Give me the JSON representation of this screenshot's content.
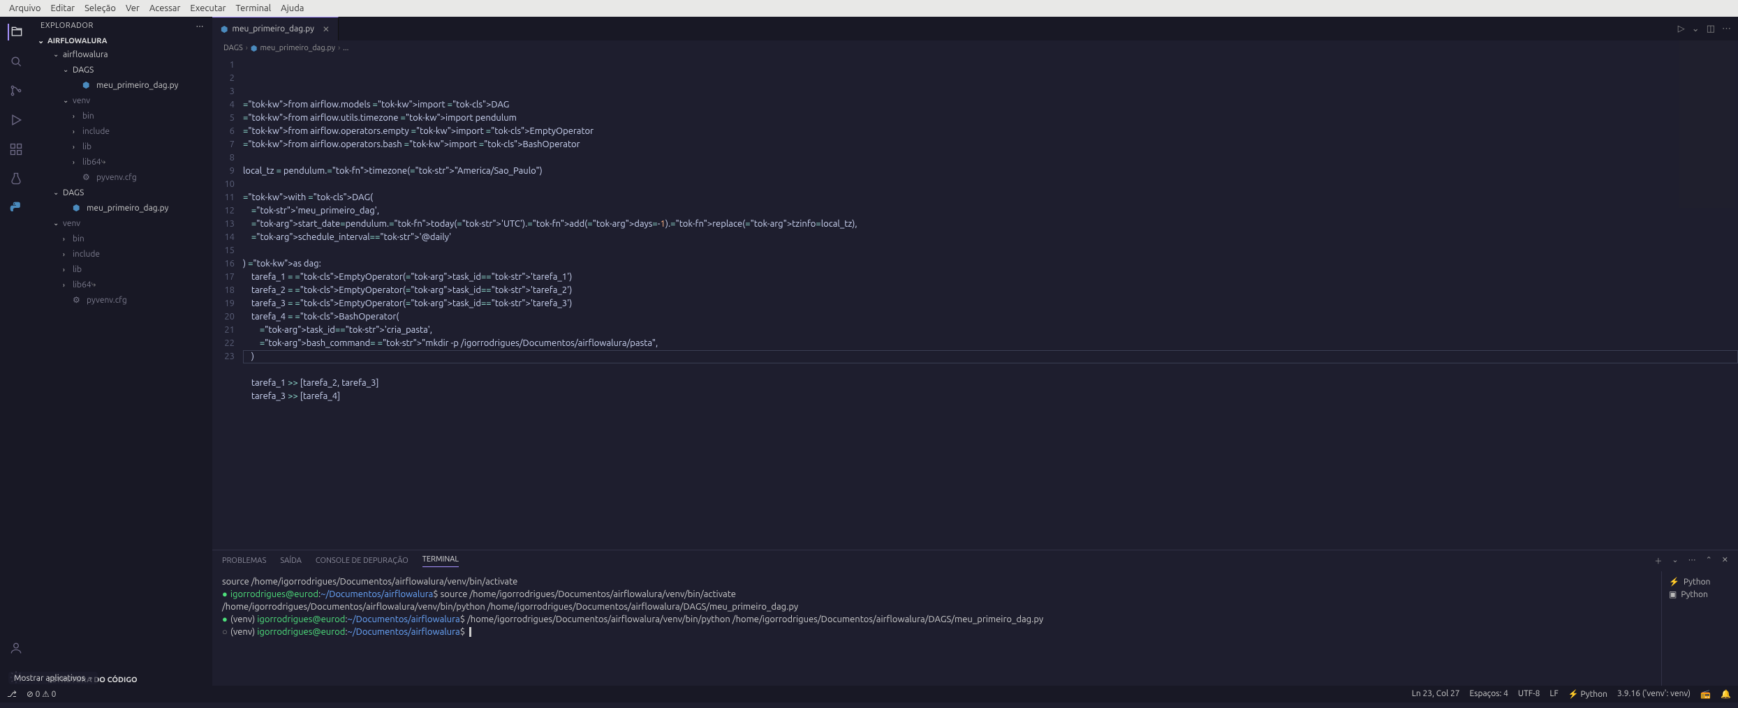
{
  "menubar": [
    "Arquivo",
    "Editar",
    "Seleção",
    "Ver",
    "Acessar",
    "Executar",
    "Terminal",
    "Ajuda"
  ],
  "explorer_title": "EXPLORADOR",
  "project_name": "AIRFLOWALURA",
  "tree": {
    "folders": [
      {
        "name": "airflowalura",
        "expanded": true,
        "children": [
          {
            "name": "DAGS",
            "expanded": true,
            "children": [
              {
                "name": "meu_primeiro_dag.py",
                "icon": "py"
              }
            ]
          },
          {
            "name": "venv",
            "expanded": true,
            "dim": true,
            "children": [
              {
                "name": "bin",
                "folder": true,
                "dim": true
              },
              {
                "name": "include",
                "folder": true,
                "dim": true
              },
              {
                "name": "lib",
                "folder": true,
                "dim": true
              },
              {
                "name": "lib64",
                "folder": true,
                "dim": true,
                "link": true
              },
              {
                "name": "pyvenv.cfg",
                "dim": true
              }
            ]
          }
        ]
      },
      {
        "name": "DAGS",
        "expanded": true,
        "children": [
          {
            "name": "meu_primeiro_dag.py",
            "icon": "py"
          }
        ]
      },
      {
        "name": "venv",
        "expanded": true,
        "dim": true,
        "children": [
          {
            "name": "bin",
            "folder": true,
            "dim": true
          },
          {
            "name": "include",
            "folder": true,
            "dim": true
          },
          {
            "name": "lib",
            "folder": true,
            "dim": true
          },
          {
            "name": "lib64",
            "folder": true,
            "dim": true,
            "link": true
          },
          {
            "name": "pyvenv.cfg",
            "dim": true
          }
        ]
      }
    ]
  },
  "outline_title": "ESTRUTURA DO CÓDIGO",
  "tab": {
    "label": "meu_primeiro_dag.py"
  },
  "breadcrumb": [
    "DAGS",
    "meu_primeiro_dag.py",
    "..."
  ],
  "code_lines": 23,
  "code_raw": "from airflow.models import DAG\nfrom airflow.utils.timezone import pendulum\nfrom airflow.operators.empty import EmptyOperator\nfrom airflow.operators.bash import BashOperator\n\nlocal_tz = pendulum.timezone(\"America/Sao_Paulo\")\n\nwith DAG(\n    'meu_primeiro_dag',\n    start_date=pendulum.today('UTC').add(days=-1).replace(tzinfo=local_tz),\n    schedule_interval='@daily'\n\n) as dag:\n    tarefa_1 = EmptyOperator(task_id='tarefa_1')\n    tarefa_2 = EmptyOperator(task_id='tarefa_2')\n    tarefa_3 = EmptyOperator(task_id='tarefa_3')\n    tarefa_4 = BashOperator(\n        task_id='cria_pasta',\n        bash_command= \"mkdir -p /igorrodrigues/Documentos/airflowalura/pasta\",\n    )\n\n    tarefa_1 >> [tarefa_2, tarefa_3]\n    tarefa_3 >> [tarefa_4]",
  "panel_tabs": {
    "problems": "PROBLEMAS",
    "output": "SAÍDA",
    "debug": "CONSOLE DE DEPURAÇÃO",
    "terminal": "TERMINAL"
  },
  "terminal": {
    "lines": [
      {
        "style": "plain",
        "text": "source /home/igorrodrigues/Documentos/airflowalura/venv/bin/activate"
      },
      {
        "style": "prompt",
        "user": "igorrodrigues@eurod",
        "path": "~/Documentos/airflowalura",
        "cmd": "source /home/igorrodrigues/Documentos/airflowalura/venv/bin/activate",
        "marker": "green"
      },
      {
        "style": "plain",
        "text": "/home/igorrodrigues/Documentos/airflowalura/venv/bin/python /home/igorrodrigues/Documentos/airflowalura/DAGS/meu_primeiro_dag.py"
      },
      {
        "style": "venv",
        "user": "igorrodrigues@eurod",
        "path": "~/Documentos/airflowalura",
        "cmd": "/home/igorrodrigues/Documentos/airflowalura/venv/bin/python /home/igorrodrigues/Documentos/airflowalura/DAGS/meu_primeiro_dag.py",
        "marker": "green"
      },
      {
        "style": "venv",
        "user": "igorrodrigues@eurod",
        "path": "~/Documentos/airflowalura",
        "cmd": "",
        "marker": "gray",
        "cursor": true
      }
    ],
    "side": [
      "Python",
      "Python"
    ]
  },
  "statusbar": {
    "left": [
      "⎇",
      "⊘ 0 ⚠ 0"
    ],
    "right": [
      "Ln 23, Col 27",
      "Espaços: 4",
      "UTF-8",
      "LF",
      "⚡ Python",
      "3.9.16 ('venv': venv)",
      "📻",
      "🔔"
    ]
  },
  "overlay": "Mostrar aplicativos"
}
